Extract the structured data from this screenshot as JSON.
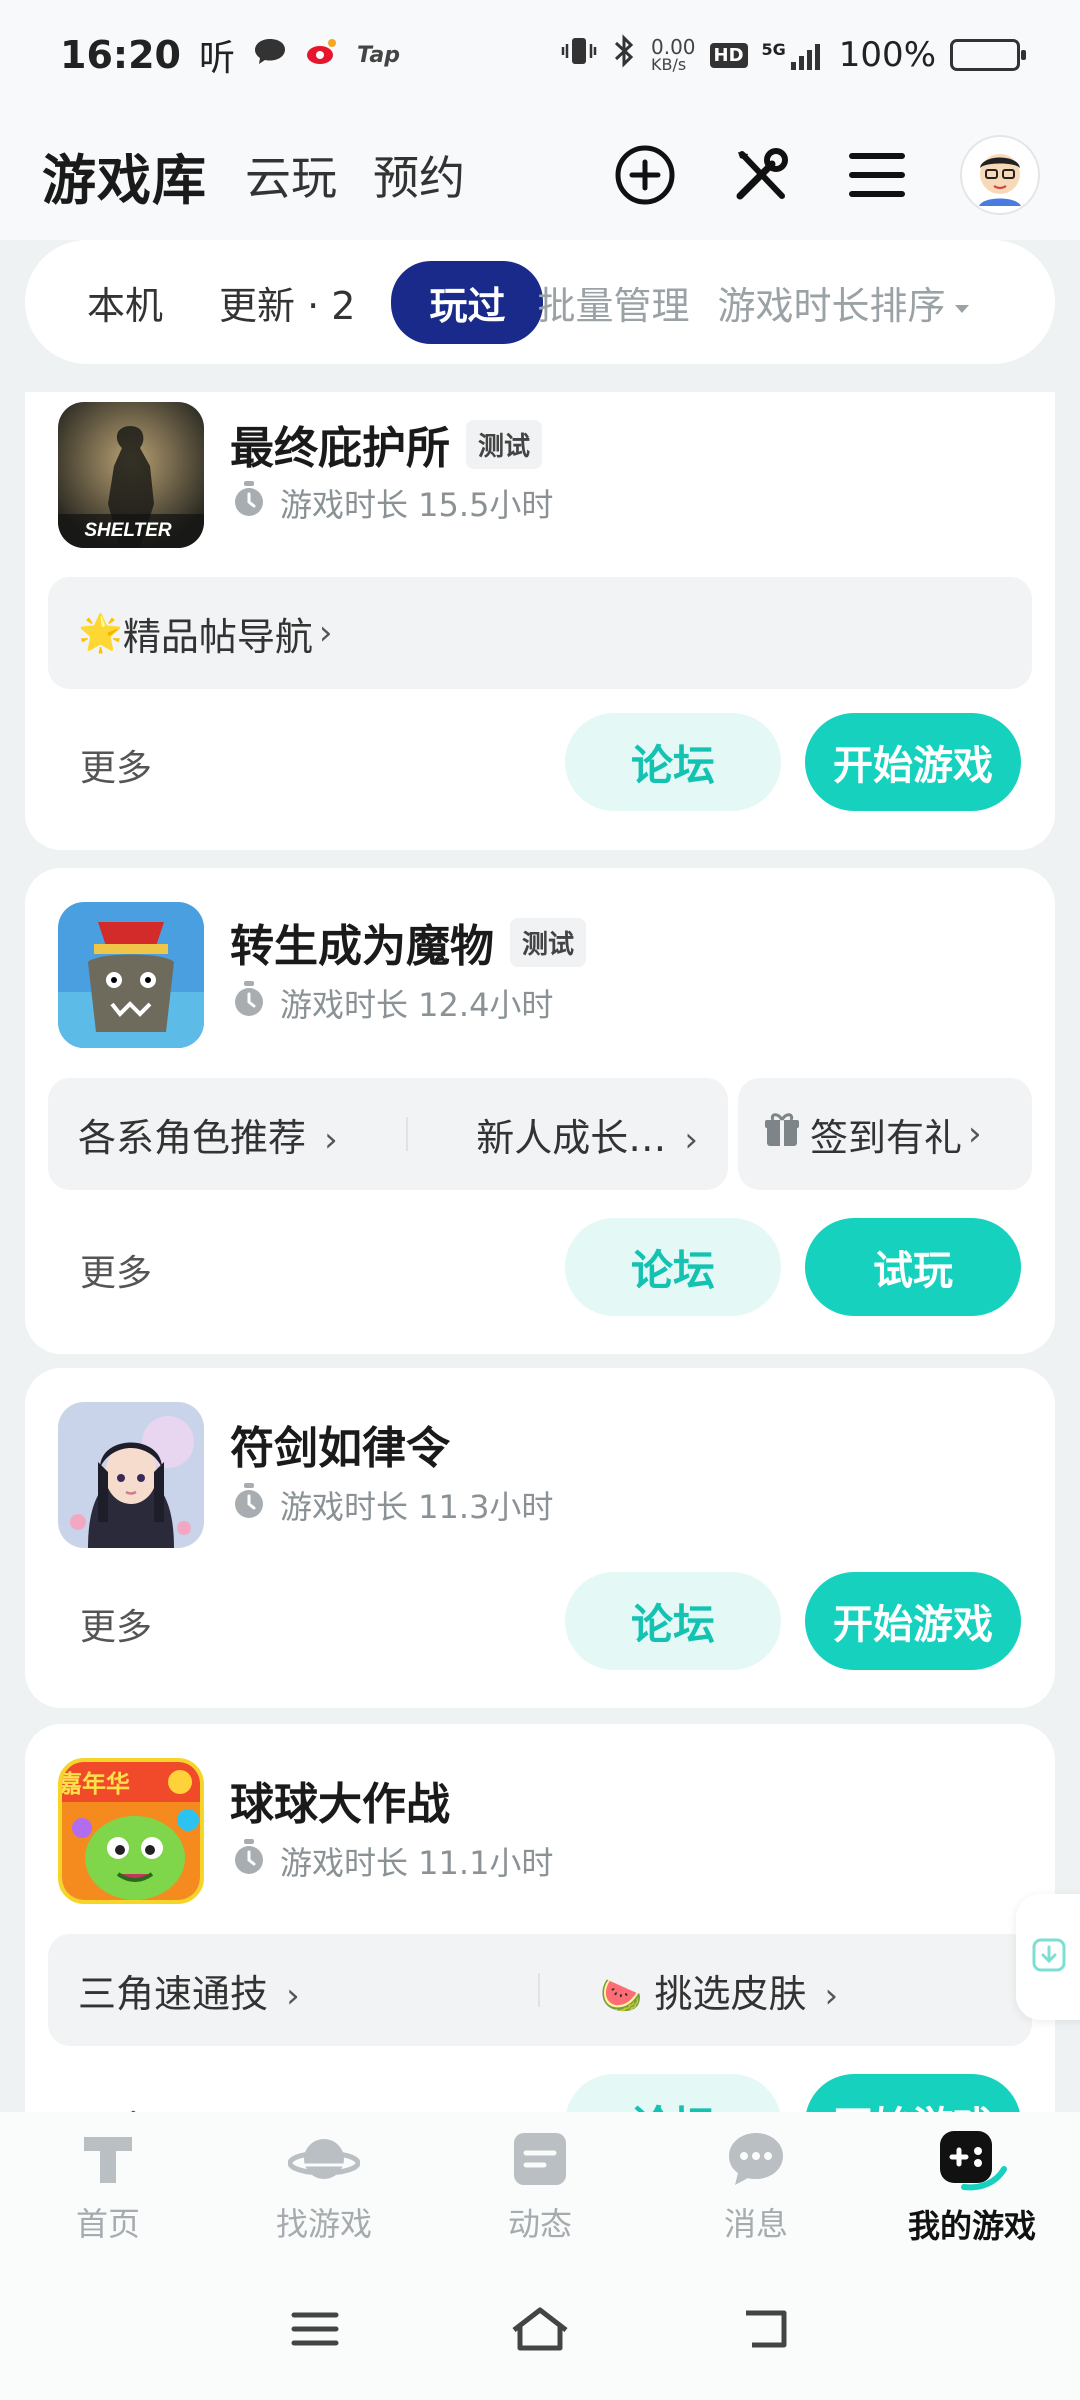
{
  "status_bar": {
    "time": "16:20",
    "carrier_icon": "听",
    "tap_label": "Tap",
    "net_speed_top": "0.00",
    "net_speed_bottom": "KB/s",
    "hd": "HD",
    "signal_label": "5G",
    "battery": "100%"
  },
  "header": {
    "title": "游戏库",
    "tabs": [
      "云玩",
      "预约"
    ],
    "icons": [
      "add-circle-icon",
      "tools-icon",
      "menu-icon",
      "avatar"
    ]
  },
  "filter": {
    "tabs": [
      "本机",
      "更新 · 2",
      "玩过",
      "批量管理"
    ],
    "active": "玩过",
    "sort_label": "游戏时长排序"
  },
  "games": [
    {
      "name": "最终庇护所",
      "badge": "测试",
      "playtime": "游戏时长 15.5小时",
      "icon_text": "SHELTER",
      "links": [
        {
          "emoji": "🌟",
          "label": "精品帖导航"
        }
      ],
      "more": "更多",
      "forum": "论坛",
      "action": "开始游戏"
    },
    {
      "name": "转生成为魔物",
      "badge": "测试",
      "playtime": "游戏时长 12.4小时",
      "links": [
        {
          "label": "各系角色推荐"
        },
        {
          "label": "新人成长…"
        }
      ],
      "gift_link": "签到有礼",
      "more": "更多",
      "forum": "论坛",
      "action": "试玩"
    },
    {
      "name": "符剑如律令",
      "badge": "",
      "playtime": "游戏时长 11.3小时",
      "more": "更多",
      "forum": "论坛",
      "action": "开始游戏"
    },
    {
      "name": "球球大作战",
      "badge": "",
      "playtime": "游戏时长 11.1小时",
      "icon_text": "嘉年华",
      "links": [
        {
          "label": "三角速通技"
        },
        {
          "emoji": "🍉",
          "label": "挑选皮肤"
        }
      ],
      "more": "更多",
      "forum": "论坛",
      "action": "开始游戏"
    }
  ],
  "bottom_nav": [
    {
      "label": "首页",
      "icon": "home-t-icon"
    },
    {
      "label": "找游戏",
      "icon": "planet-icon"
    },
    {
      "label": "动态",
      "icon": "feed-icon"
    },
    {
      "label": "消息",
      "icon": "chat-icon"
    },
    {
      "label": "我的游戏",
      "icon": "gamepad-icon",
      "active": true
    }
  ],
  "colors": {
    "accent": "#17d1bf",
    "accent_light": "#e4f8f6",
    "active_tab": "#1a2a8a",
    "background": "#eef2f3"
  }
}
